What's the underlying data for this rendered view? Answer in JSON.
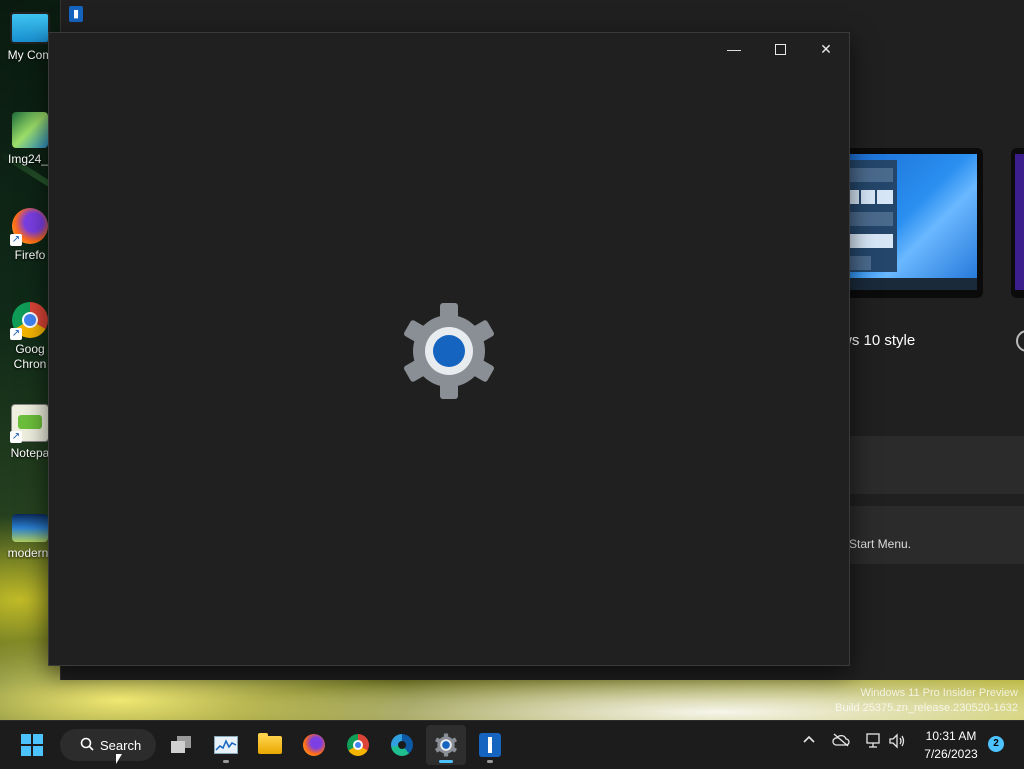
{
  "desktop": {
    "icons": [
      {
        "label": "My Com",
        "icon": "monitor-icon"
      },
      {
        "label": "Img24_(",
        "icon": "image-file-icon"
      },
      {
        "label": "Firefo",
        "icon": "firefox-icon"
      },
      {
        "label": "Goog\nChron",
        "icon": "chrome-icon"
      },
      {
        "label": "Notepa",
        "icon": "notepad-icon"
      },
      {
        "label": "modern-",
        "icon": "image-file-icon"
      }
    ]
  },
  "background_window": {
    "style_option_label": "ws 10 style",
    "row_text": "Start Menu.",
    "colors": {
      "bg": "#202020",
      "panel": "#2b2b2b"
    }
  },
  "loading_window": {
    "minimize_glyph": "—",
    "maximize_glyph": "☐",
    "close_glyph": "✕",
    "center_icon": "settings-gear-icon",
    "colors": {
      "gear": "#8a8f96",
      "gear_center": "#1565c0"
    }
  },
  "watermark": {
    "line1": "Windows 11 Pro Insider Preview",
    "line2": "Build 25375.zn_release.230520-1632"
  },
  "taskbar": {
    "search_label": "Search",
    "pinned_apps": [
      "start-icon",
      "task-view-icon",
      "task-manager-icon",
      "file-explorer-icon",
      "firefox-icon",
      "chrome-icon",
      "edge-icon",
      "settings-icon",
      "start11-icon"
    ],
    "clock_time": "10:31 AM",
    "clock_date": "7/26/2023",
    "notification_count": "2",
    "accent": "#4cc2ff"
  }
}
